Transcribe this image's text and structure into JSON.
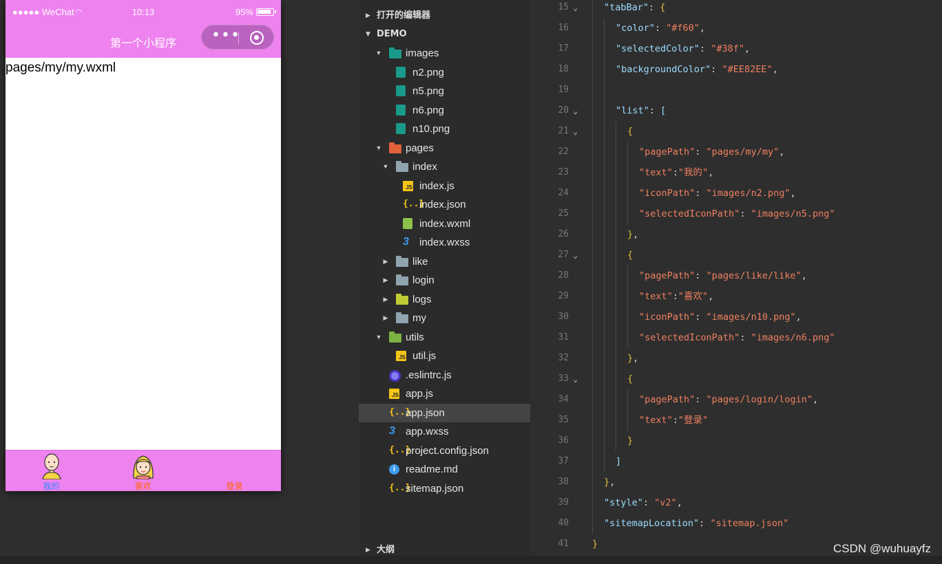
{
  "simulator": {
    "status": {
      "signal": "●●●●● WeChat",
      "time": "10:13",
      "battery": "95%"
    },
    "nav_title": "第一个小程序",
    "page_text": "pages/my/my.wxml",
    "tab_bar": {
      "color": "#f60",
      "selected_color": "#38f",
      "background_color": "#EE82EE",
      "items": [
        {
          "label": "我的",
          "icon": "bald-man-avatar-icon",
          "selected": true
        },
        {
          "label": "喜欢",
          "icon": "blonde-girl-avatar-icon",
          "selected": false
        },
        {
          "label": "登录",
          "icon": "",
          "selected": false
        }
      ]
    }
  },
  "explorer": {
    "open_editors": "打开的编辑器",
    "project": "DEMO",
    "outline": "大纲",
    "tree": [
      {
        "name": "images",
        "type": "folder-images",
        "depth": 1,
        "expanded": true
      },
      {
        "name": "n2.png",
        "type": "image",
        "depth": 2
      },
      {
        "name": "n5.png",
        "type": "image",
        "depth": 2
      },
      {
        "name": "n6.png",
        "type": "image",
        "depth": 2
      },
      {
        "name": "n10.png",
        "type": "image",
        "depth": 2
      },
      {
        "name": "pages",
        "type": "folder-pages",
        "depth": 1,
        "expanded": true
      },
      {
        "name": "index",
        "type": "folder-open",
        "depth": 2,
        "expanded": true
      },
      {
        "name": "index.js",
        "type": "js",
        "depth": 3
      },
      {
        "name": "index.json",
        "type": "json",
        "depth": 3
      },
      {
        "name": "index.wxml",
        "type": "wxml",
        "depth": 3
      },
      {
        "name": "index.wxss",
        "type": "css",
        "depth": 3
      },
      {
        "name": "like",
        "type": "folder",
        "depth": 2,
        "expanded": false
      },
      {
        "name": "login",
        "type": "folder",
        "depth": 2,
        "expanded": false
      },
      {
        "name": "logs",
        "type": "folder-logs",
        "depth": 2,
        "expanded": false
      },
      {
        "name": "my",
        "type": "folder",
        "depth": 2,
        "expanded": false
      },
      {
        "name": "utils",
        "type": "folder-utils",
        "depth": 1,
        "expanded": true
      },
      {
        "name": "util.js",
        "type": "js",
        "depth": 2
      },
      {
        "name": ".eslintrc.js",
        "type": "eslint",
        "depth": 1
      },
      {
        "name": "app.js",
        "type": "js",
        "depth": 1
      },
      {
        "name": "app.json",
        "type": "json",
        "depth": 1,
        "selected": true
      },
      {
        "name": "app.wxss",
        "type": "css",
        "depth": 1
      },
      {
        "name": "project.config.json",
        "type": "json",
        "depth": 1
      },
      {
        "name": "readme.md",
        "type": "info",
        "depth": 1
      },
      {
        "name": "sitemap.json",
        "type": "json",
        "depth": 1
      }
    ]
  },
  "editor": {
    "lines": [
      {
        "n": "15",
        "fold": true,
        "indent": 1,
        "tokens": [
          [
            "k",
            "\"tabBar\""
          ],
          [
            "p",
            ": "
          ],
          [
            "br",
            "{"
          ]
        ]
      },
      {
        "n": "16",
        "indent": 2,
        "tokens": [
          [
            "k",
            "\"color\""
          ],
          [
            "p",
            ": "
          ],
          [
            "s",
            "\"#f60\""
          ],
          [
            "p",
            ","
          ]
        ]
      },
      {
        "n": "17",
        "indent": 2,
        "tokens": [
          [
            "k",
            "\"selectedColor\""
          ],
          [
            "p",
            ": "
          ],
          [
            "s",
            "\"#38f\""
          ],
          [
            "p",
            ","
          ]
        ]
      },
      {
        "n": "18",
        "indent": 2,
        "tokens": [
          [
            "k",
            "\"backgroundColor\""
          ],
          [
            "p",
            ": "
          ],
          [
            "s",
            "\"#EE82EE\""
          ],
          [
            "p",
            ","
          ]
        ]
      },
      {
        "n": "19",
        "indent": 2,
        "tokens": []
      },
      {
        "n": "20",
        "fold": true,
        "indent": 2,
        "tokens": [
          [
            "k",
            "\"list\""
          ],
          [
            "p",
            ": "
          ],
          [
            "k",
            "["
          ]
        ]
      },
      {
        "n": "21",
        "fold": true,
        "indent": 3,
        "tokens": [
          [
            "br",
            "{"
          ]
        ]
      },
      {
        "n": "22",
        "indent": 4,
        "tokens": [
          [
            "s",
            "\"pagePath\""
          ],
          [
            "p",
            ": "
          ],
          [
            "s",
            "\"pages/my/my\""
          ],
          [
            "p",
            ","
          ]
        ]
      },
      {
        "n": "23",
        "indent": 4,
        "tokens": [
          [
            "s",
            "\"text\""
          ],
          [
            "p",
            ":"
          ],
          [
            "s",
            "\"我的\""
          ],
          [
            "p",
            ","
          ]
        ]
      },
      {
        "n": "24",
        "indent": 4,
        "tokens": [
          [
            "s",
            "\"iconPath\""
          ],
          [
            "p",
            ": "
          ],
          [
            "s",
            "\"images/n2.png\""
          ],
          [
            "p",
            ","
          ]
        ]
      },
      {
        "n": "25",
        "indent": 4,
        "tokens": [
          [
            "s",
            "\"selectedIconPath\""
          ],
          [
            "p",
            ": "
          ],
          [
            "s",
            "\"images/n5.png\""
          ]
        ]
      },
      {
        "n": "26",
        "indent": 3,
        "tokens": [
          [
            "br",
            "}"
          ],
          [
            "p",
            ","
          ]
        ]
      },
      {
        "n": "27",
        "fold": true,
        "indent": 3,
        "tokens": [
          [
            "br",
            "{"
          ]
        ]
      },
      {
        "n": "28",
        "indent": 4,
        "tokens": [
          [
            "s",
            "\"pagePath\""
          ],
          [
            "p",
            ": "
          ],
          [
            "s",
            "\"pages/like/like\""
          ],
          [
            "p",
            ","
          ]
        ]
      },
      {
        "n": "29",
        "indent": 4,
        "tokens": [
          [
            "s",
            "\"text\""
          ],
          [
            "p",
            ":"
          ],
          [
            "s",
            "\"喜欢\""
          ],
          [
            "p",
            ","
          ]
        ]
      },
      {
        "n": "30",
        "indent": 4,
        "tokens": [
          [
            "s",
            "\"iconPath\""
          ],
          [
            "p",
            ": "
          ],
          [
            "s",
            "\"images/n10.png\""
          ],
          [
            "p",
            ","
          ]
        ]
      },
      {
        "n": "31",
        "indent": 4,
        "tokens": [
          [
            "s",
            "\"selectedIconPath\""
          ],
          [
            "p",
            ": "
          ],
          [
            "s",
            "\"images/n6.png\""
          ]
        ]
      },
      {
        "n": "32",
        "indent": 3,
        "tokens": [
          [
            "br",
            "}"
          ],
          [
            "p",
            ","
          ]
        ]
      },
      {
        "n": "33",
        "fold": true,
        "indent": 3,
        "tokens": [
          [
            "br",
            "{"
          ]
        ]
      },
      {
        "n": "34",
        "indent": 4,
        "tokens": [
          [
            "s",
            "\"pagePath\""
          ],
          [
            "p",
            ": "
          ],
          [
            "s",
            "\"pages/login/login\""
          ],
          [
            "p",
            ","
          ]
        ]
      },
      {
        "n": "35",
        "indent": 4,
        "tokens": [
          [
            "s",
            "\"text\""
          ],
          [
            "p",
            ":"
          ],
          [
            "s",
            "\"登录\""
          ]
        ]
      },
      {
        "n": "36",
        "indent": 3,
        "tokens": [
          [
            "br",
            "}"
          ]
        ]
      },
      {
        "n": "37",
        "indent": 2,
        "tokens": [
          [
            "k",
            "]"
          ]
        ]
      },
      {
        "n": "38",
        "indent": 1,
        "tokens": [
          [
            "br",
            "}"
          ],
          [
            "p",
            ","
          ]
        ]
      },
      {
        "n": "39",
        "indent": 1,
        "tokens": [
          [
            "k",
            "\"style\""
          ],
          [
            "p",
            ": "
          ],
          [
            "s",
            "\"v2\""
          ],
          [
            "p",
            ","
          ]
        ]
      },
      {
        "n": "40",
        "indent": 1,
        "tokens": [
          [
            "k",
            "\"sitemapLocation\""
          ],
          [
            "p",
            ": "
          ],
          [
            "s",
            "\"sitemap.json\""
          ]
        ]
      },
      {
        "n": "41",
        "indent": 0,
        "tokens": [
          [
            "br",
            "}"
          ]
        ]
      }
    ]
  },
  "watermark": "CSDN @wuhuayfz"
}
